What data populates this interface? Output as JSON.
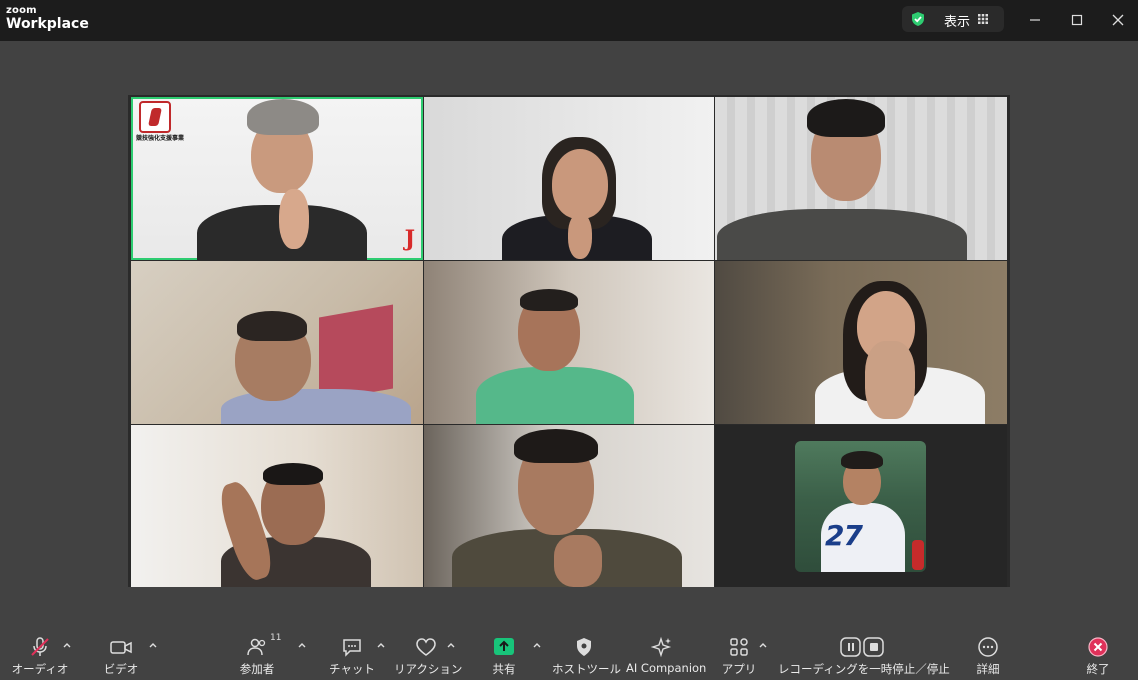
{
  "app": {
    "logo_small": "zoom",
    "logo_main": "Workplace"
  },
  "titlebar": {
    "view_label": "表示",
    "security_color": "#2ecc71",
    "window_controls": [
      "minimize-icon",
      "maximize-icon",
      "close-icon"
    ]
  },
  "grid": {
    "active_speaker_color": "#2ecc71",
    "tiles": [
      {
        "id": 1,
        "badge_text": "競技強化支援事業",
        "logo_letter": "J"
      },
      {
        "id": 2
      },
      {
        "id": 3
      },
      {
        "id": 4
      },
      {
        "id": 5
      },
      {
        "id": 6
      },
      {
        "id": 7
      },
      {
        "id": 8
      },
      {
        "id": 9,
        "profile_photo_number": "27"
      }
    ]
  },
  "toolbar": {
    "audio_label": "オーディオ",
    "video_label": "ビデオ",
    "participants_label": "参加者",
    "participants_count": "11",
    "chat_label": "チャット",
    "reactions_label": "リアクション",
    "share_label": "共有",
    "host_tools_label": "ホストツール",
    "ai_label": "AI Companion",
    "apps_label": "アプリ",
    "recording_label": "レコーディングを一時停止／停止",
    "more_label": "詳細",
    "end_label": "終了",
    "mute_color": "#e0315a",
    "share_color": "#18c47a",
    "end_color": "#e0315a"
  }
}
